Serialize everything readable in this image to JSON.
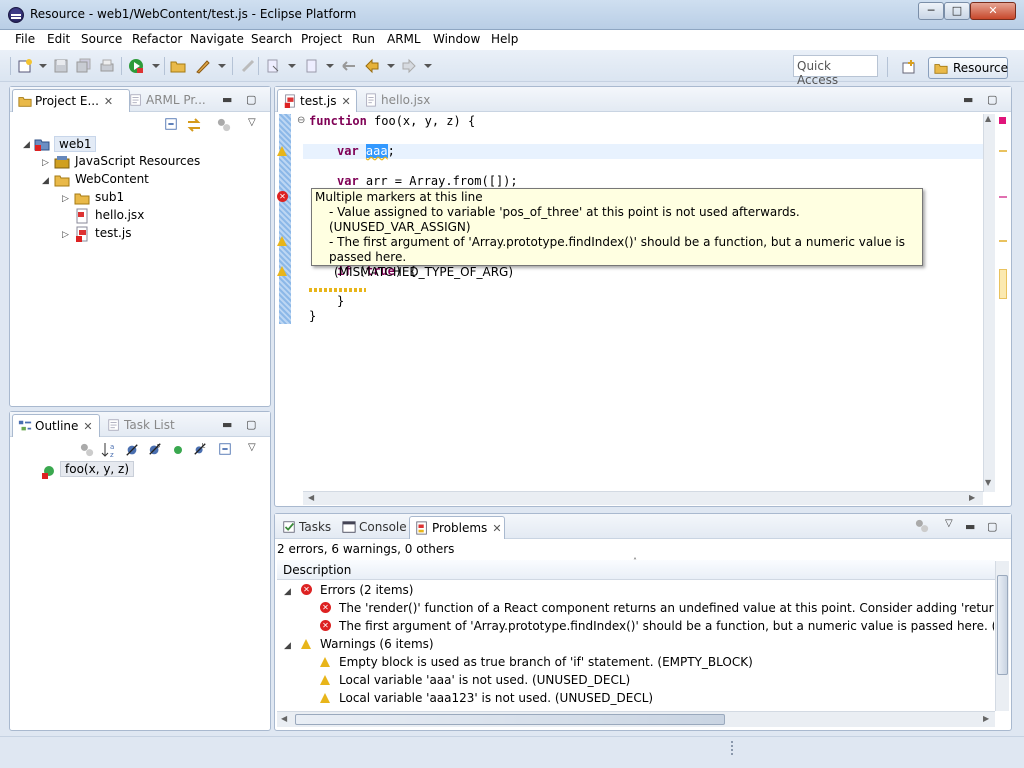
{
  "window": {
    "title": "Resource - web1/WebContent/test.js - Eclipse Platform",
    "min": "─",
    "max": "□",
    "close": "✕"
  },
  "menu": [
    "File",
    "Edit",
    "Source",
    "Refactor",
    "Navigate",
    "Search",
    "Project",
    "Run",
    "ARML",
    "Window",
    "Help"
  ],
  "quick_access": {
    "placeholder": "Quick Access"
  },
  "perspective": {
    "label": "Resource"
  },
  "project_explorer": {
    "tabs": [
      {
        "label": "Project E...",
        "close": "✕"
      },
      {
        "label": "ARML Pr..."
      }
    ],
    "tree": [
      {
        "label": "web1",
        "depth": 0,
        "expanded": true
      },
      {
        "label": "JavaScript Resources",
        "depth": 1,
        "expanded": false
      },
      {
        "label": "WebContent",
        "depth": 1,
        "expanded": true
      },
      {
        "label": "sub1",
        "depth": 2,
        "expanded": false
      },
      {
        "label": "hello.jsx",
        "depth": 2
      },
      {
        "label": "test.js",
        "depth": 2,
        "expanded": false
      }
    ]
  },
  "outline": {
    "tabs": [
      {
        "label": "Outline",
        "close": "✕"
      },
      {
        "label": "Task List"
      }
    ],
    "item": "foo(x, y, z)"
  },
  "editor": {
    "tabs": [
      {
        "label": "test.js",
        "close": "✕"
      },
      {
        "label": "hello.jsx"
      }
    ],
    "code": {
      "line1_kw": "function",
      "line1_rest": " foo(x, y, z) {",
      "line2_kw": "var",
      "line2_sel": "aaa",
      "line2_end": ";",
      "line3_kw": "var",
      "line3_rest": " arr = Array.from([]);",
      "line4_kw": "if",
      "line4_open": " (",
      "line4_true": "true",
      "line4_close": ") {",
      "line5": "}",
      "line6": "}"
    }
  },
  "hover": {
    "title": "Multiple markers at this line",
    "line1": "- Value assigned to variable 'pos_of_three' at this point is not used afterwards. (UNUSED_VAR_ASSIGN)",
    "line2": "- The first argument of 'Array.prototype.findIndex()' should be a function, but a numeric value is passed here.",
    "line3": "(MISMATCHED_TYPE_OF_ARG)"
  },
  "bottom": {
    "tabs": [
      {
        "label": "Tasks"
      },
      {
        "label": "Console"
      },
      {
        "label": "Problems",
        "close": "✕"
      }
    ],
    "summary": "2 errors, 6 warnings, 0 others",
    "column": "Description",
    "errors_group": "Errors (2 items)",
    "errors": [
      "The 'render()' function of a React component returns an undefined value at this point. Consider adding 'return' keyword b",
      "The first argument of 'Array.prototype.findIndex()' should be a function, but a numeric value is passed here. (MISMATCHI"
    ],
    "warnings_group": "Warnings (6 items)",
    "warnings": [
      "Empty block is used as true branch of 'if' statement. (EMPTY_BLOCK)",
      "Local variable 'aaa' is not used. (UNUSED_DECL)",
      "Local variable 'aaa123' is not used. (UNUSED_DECL)"
    ]
  },
  "colors": {
    "keyword": "#7f0055",
    "error": "#dd2222",
    "warning": "#e8b51a",
    "hover_bg": "#ffffe1",
    "selection": "#3399ff"
  }
}
